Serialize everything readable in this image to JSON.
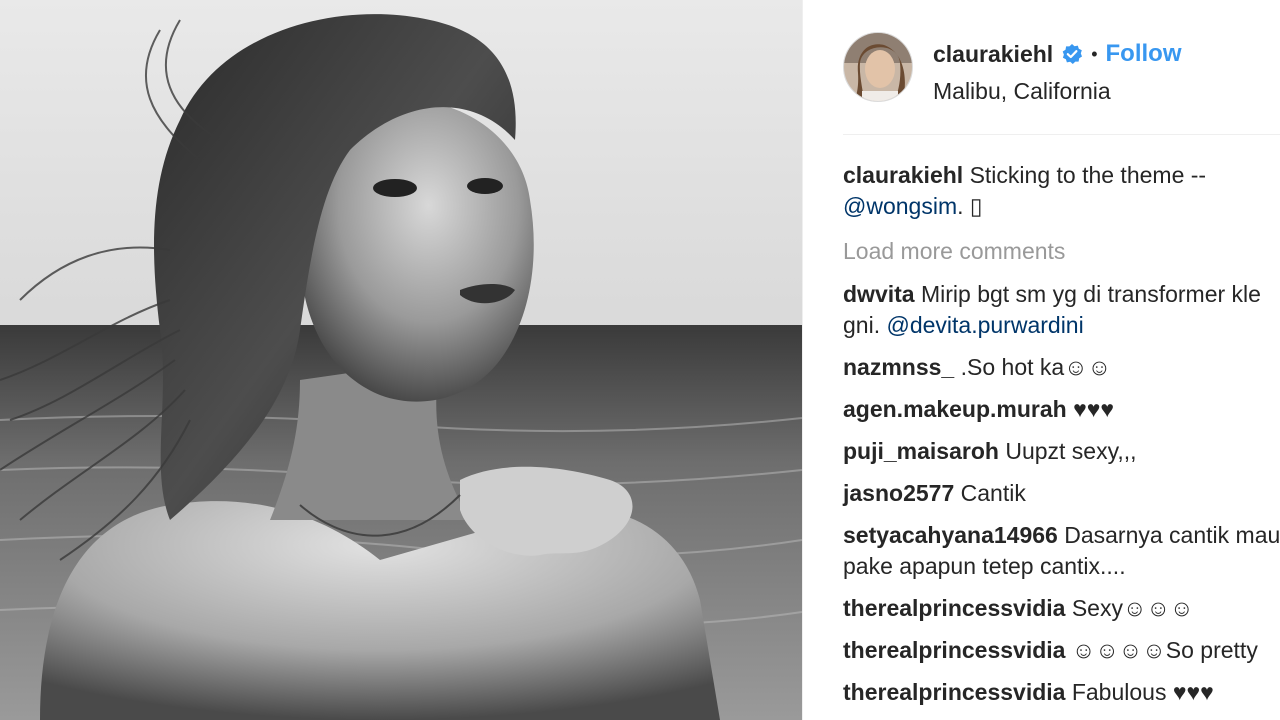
{
  "post": {
    "username": "claurakiehl",
    "follow_label": "Follow",
    "separator": "•",
    "location": "Malibu, California",
    "caption": {
      "username": "claurakiehl",
      "text_line1": "Sticking to the theme --",
      "mention": "@wongsim",
      "text_after_mention": ". ▯"
    },
    "load_more_label": "Load more comments"
  },
  "comments": [
    {
      "username": "dwvita",
      "text": "Mirip bgt sm yg di transformer kle",
      "line2_prefix": "gni. ",
      "mention": "@devita.purwardini"
    },
    {
      "username": "nazmnss_",
      "text": ".So hot ka☺☺"
    },
    {
      "username": "agen.makeup.murah",
      "text": "♥♥♥"
    },
    {
      "username": "puji_maisaroh",
      "text": "Uupzt sexy,,,"
    },
    {
      "username": "jasno2577",
      "text": "Cantik"
    },
    {
      "username": "setyacahyana14966",
      "text": "Dasarnya cantik mau",
      "line2": "pake apapun tetep cantix...."
    },
    {
      "username": "therealprincessvidia",
      "text": "Sexy☺☺☺"
    },
    {
      "username": "therealprincessvidia",
      "text": "☺☺☺☺So pretty"
    },
    {
      "username": "therealprincessvidia",
      "text": "Fabulous ♥♥♥"
    }
  ],
  "colors": {
    "accent": "#3897f0",
    "mention": "#003569",
    "muted": "#999999",
    "text": "#262626"
  }
}
